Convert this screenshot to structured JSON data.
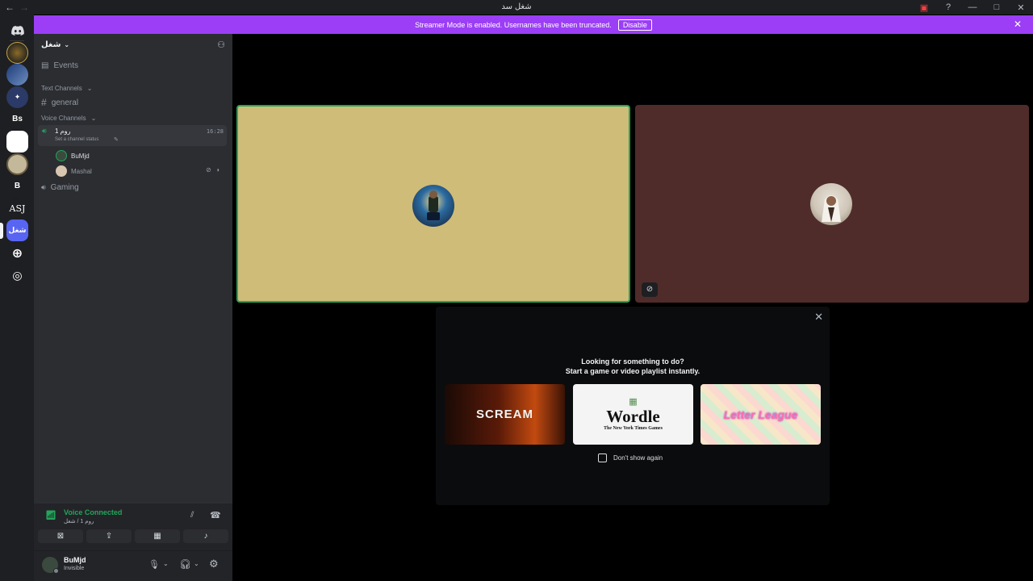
{
  "window": {
    "title": "شغل سد"
  },
  "banner": {
    "text": "Streamer Mode is enabled. Usernames have been truncated.",
    "disable_label": "Disable"
  },
  "guild_labels": {
    "bs": "Bs",
    "b": "B",
    "asj": "ASJ",
    "active": "شغل"
  },
  "server": {
    "name": "شغل"
  },
  "channels": {
    "events": "Events",
    "text_category": "Text Channels",
    "general": "general",
    "voice_category": "Voice Channels",
    "voice_active": "روم 1",
    "voice_active_time": "16:28",
    "status_hint": "Set a channel status",
    "members": [
      "BuMjd",
      "Mashal"
    ],
    "gaming": "Gaming"
  },
  "voice_panel": {
    "status": "Voice Connected",
    "location": "روم 1 / شغل"
  },
  "user_panel": {
    "name": "BuMjd",
    "status": "Invisible"
  },
  "activity": {
    "title_line1": "Looking for something to do?",
    "title_line2": "Start a game or video playlist instantly.",
    "cards": [
      "SCREAM",
      "Wordle",
      "Letter League"
    ],
    "wordle_sub": "The New York Times Games",
    "dont_show": "Don't show again"
  },
  "colors": {
    "accent": "#9b3ef5",
    "tile1": "#cfbc78",
    "tile2": "#4f2c2a",
    "speaking": "#23a55a"
  }
}
